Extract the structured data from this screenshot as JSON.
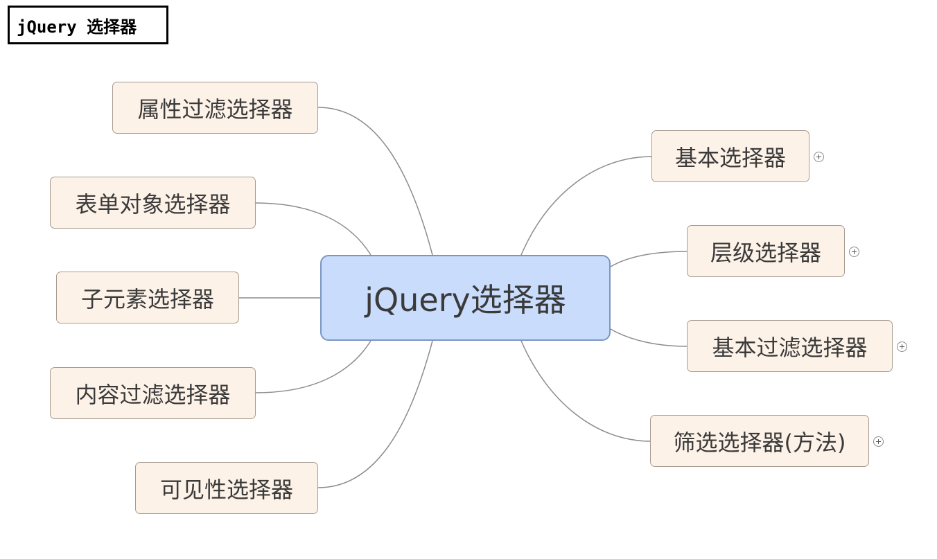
{
  "title": "jQuery 选择器",
  "center": "jQuery选择器",
  "left_nodes": [
    "属性过滤选择器",
    "表单对象选择器",
    "子元素选择器",
    "内容过滤选择器",
    "可见性选择器"
  ],
  "right_nodes": [
    "基本选择器",
    "层级选择器",
    "基本过滤选择器",
    "筛选选择器(方法)"
  ],
  "expand_icon": "plus-circle-icon",
  "colors": {
    "center_fill": "#c9dcfb",
    "center_border": "#7b96c2",
    "node_fill": "#fdf2e8",
    "node_border": "#a79b90",
    "connector": "#8c8c8c"
  }
}
